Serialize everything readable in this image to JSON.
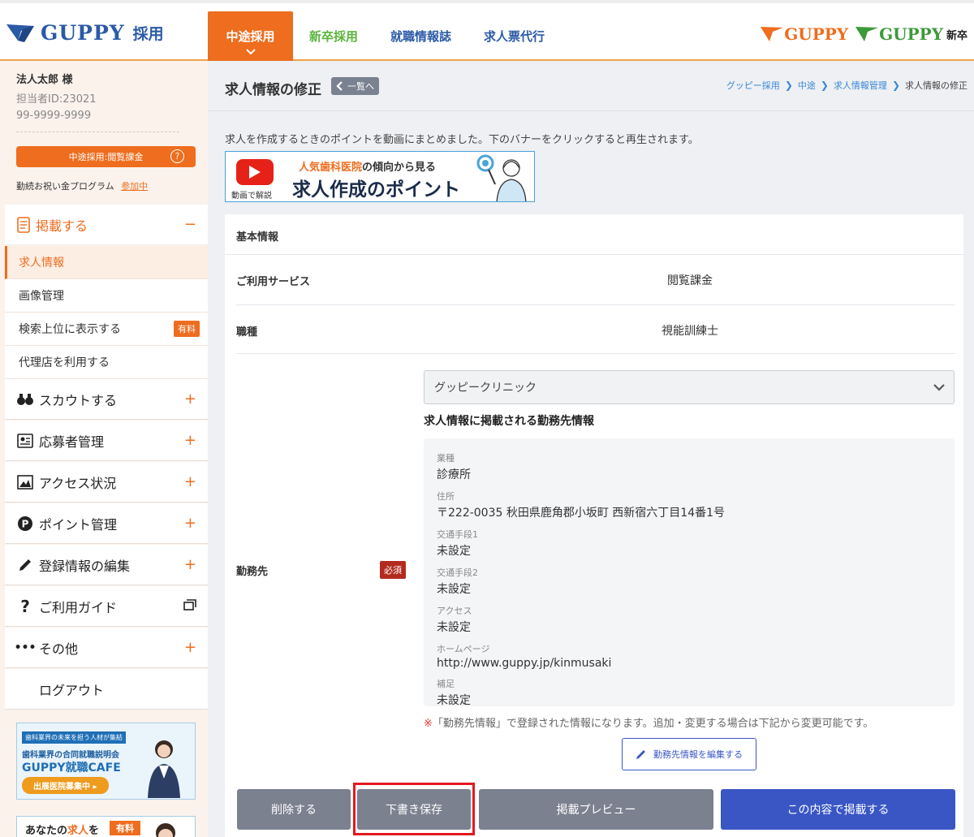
{
  "header": {
    "logo_text": "GUPPY",
    "logo_suffix": "採用",
    "tabs": [
      {
        "label": "中途採用"
      },
      {
        "label": "新卒採用"
      },
      {
        "label": "就職情報誌"
      },
      {
        "label": "求人票代行"
      }
    ],
    "right_logos": [
      {
        "text": "GUPPY",
        "suffix": ""
      },
      {
        "text": "GUPPY",
        "suffix": "新卒"
      }
    ]
  },
  "sidebar": {
    "user_name": "法人太郎 様",
    "user_id": "担当者ID:23021",
    "user_phone": "99-9999-9999",
    "plan_button": "中途採用:閲覧課金",
    "program_label": "勤続お祝い金プログラム",
    "program_status": "参加中",
    "post_menu": "掲載する",
    "sub_items": [
      {
        "label": "求人情報"
      },
      {
        "label": "画像管理"
      },
      {
        "label": "検索上位に表示する",
        "badge": "有料"
      },
      {
        "label": "代理店を利用する"
      }
    ],
    "nav_items": [
      {
        "label": "スカウトする",
        "icon": "binoculars-icon"
      },
      {
        "label": "応募者管理",
        "icon": "applicant-card-icon"
      },
      {
        "label": "アクセス状況",
        "icon": "chart-image-icon"
      },
      {
        "label": "ポイント管理",
        "icon": "point-icon"
      },
      {
        "label": "登録情報の編集",
        "icon": "pencil-icon"
      },
      {
        "label": "ご利用ガイド",
        "icon": "question-icon"
      },
      {
        "label": "その他",
        "icon": "more-dots-icon"
      },
      {
        "label": "ログアウト",
        "icon": ""
      }
    ],
    "banner1": {
      "top": "歯科業界の未来を担う人材が集結",
      "mid": "歯科業界の合同就職説明会",
      "big": "GUPPY就職CAFE",
      "btn": "出展医院募集中 ▸"
    },
    "banner2": {
      "text_a": "あなたの",
      "text_em": "求人",
      "text_b": "を",
      "badge": "有料"
    }
  },
  "main": {
    "title": "求人情報の修正",
    "back_label": "一覧へ",
    "breadcrumb": [
      "グッピー採用",
      "中途",
      "求人情報管理",
      "求人情報の修正"
    ],
    "intro": "求人を作成するときのポイントを動画にまとめました。下のバナーをクリックすると再生されます。",
    "video_banner": {
      "caption": "動画で解説",
      "line1_em": "人気歯科医院",
      "line1_rest": "の傾向から見る",
      "line2": "求人作成のポイント"
    },
    "card_title": "基本情報",
    "rows": {
      "service_label": "ご利用サービス",
      "service_value": "閲覧課金",
      "job_label": "職種",
      "job_value": "視能訓練士",
      "workplace_label": "勤務先",
      "required_badge": "必須"
    },
    "workplace_select": "グッピークリニック",
    "workplace_info_title": "求人情報に掲載される勤務先情報",
    "workplace_info": [
      {
        "key": "業種",
        "value": "診療所"
      },
      {
        "key": "住所",
        "value": "〒222-0035 秋田県鹿角郡小坂町 西新宿六丁目14番1号"
      },
      {
        "key": "交通手段1",
        "value": "未設定"
      },
      {
        "key": "交通手段2",
        "value": "未設定"
      },
      {
        "key": "アクセス",
        "value": "未設定"
      },
      {
        "key": "ホームページ",
        "value": "http://www.guppy.jp/kinmusaki"
      },
      {
        "key": "補足",
        "value": "未設定"
      }
    ],
    "note_mark": "※",
    "note": "「勤務先情報」で登録された情報になります。追加・変更する場合は下記から変更可能です。",
    "edit_button": "勤務先情報を編集する"
  },
  "footer": {
    "delete": "削除する",
    "draft": "下書き保存",
    "preview": "掲載プレビュー",
    "publish": "この内容で掲載する"
  },
  "colors": {
    "accent_orange": "#ee6d1e",
    "primary_blue": "#3a56c5",
    "brand_blue": "#2b5aa6",
    "highlight_red": "#e5171f"
  }
}
